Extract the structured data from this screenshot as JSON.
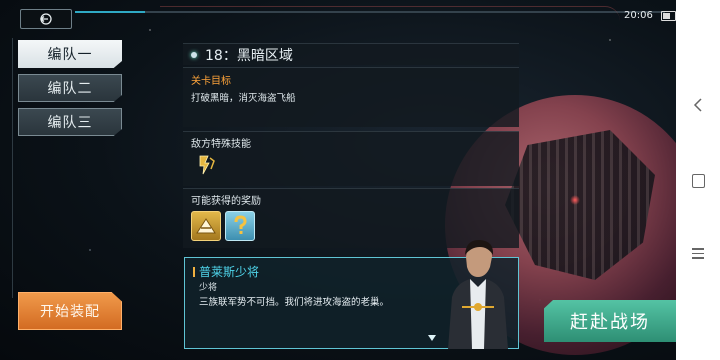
{
  "status_bar": {
    "time": "20:06"
  },
  "tabs": [
    {
      "label": "编队一",
      "active": true
    },
    {
      "label": "编队二",
      "active": false
    },
    {
      "label": "编队三",
      "active": false
    }
  ],
  "start_button": "开始装配",
  "stage": {
    "title": "18：黑暗区域",
    "goal_label": "关卡目标",
    "goal_text": "打破黑暗，消灭海盗飞船",
    "skills_label": "敌方特殊技能",
    "rewards_label": "可能获得的奖励",
    "rewards": [
      "gold-pyramid-reward-icon",
      "mystery-question-reward-icon"
    ]
  },
  "dialog": {
    "speaker": "普莱斯少将",
    "rank": "少将",
    "text": "三族联军势不可挡。我们将进攻海盗的老巢。"
  },
  "battle_button": "赶赴战场",
  "colors": {
    "accent_cyan": "#4fd4ea",
    "goal_orange": "#ffa43a",
    "start_orange": "#e8842f",
    "battle_green": "#3fa98b"
  }
}
